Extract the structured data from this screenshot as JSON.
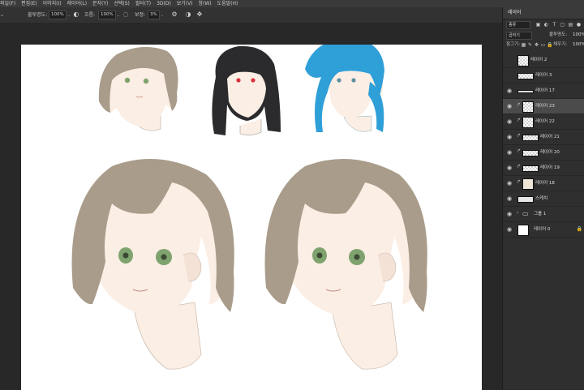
{
  "menubar": {
    "items": [
      "파일(F)",
      "편집(E)",
      "이미지(I)",
      "레이어(L)",
      "문자(Y)",
      "선택(S)",
      "필터(T)",
      "3D(D)",
      "보기(V)",
      "창(W)",
      "도움말(H)"
    ]
  },
  "options": {
    "opacity_label": "불투명도:",
    "opacity_value": "100%",
    "flow_label": "흐름:",
    "flow_value": "100%",
    "smoothing_label": "보정:",
    "smoothing_value": "3%"
  },
  "layers_panel": {
    "tab_label": "레이어",
    "filter_kind": "종류",
    "blend_mode": "곱하기",
    "opacity_label": "불투명도:",
    "opacity_value": "100%",
    "lock_label": "잠그기:",
    "fill_label": "채우기:",
    "fill_value": "100%",
    "layers": [
      {
        "name": "레이어 2"
      },
      {
        "name": "레이어 3"
      },
      {
        "name": "레이어 17"
      },
      {
        "name": "레이어 23"
      },
      {
        "name": "레이어 22"
      },
      {
        "name": "레이어 21"
      },
      {
        "name": "레이어 20"
      },
      {
        "name": "레이어 19"
      },
      {
        "name": "레이어 18"
      },
      {
        "name": "스케치"
      },
      {
        "name": "그룹 1"
      },
      {
        "name": "레이어 0"
      }
    ]
  },
  "colors": {
    "hair_brown": "#a99c8a",
    "hair_black": "#2b2b2d",
    "hair_blue": "#2f9fd8",
    "eye_green": "#7fa36e",
    "eye_red": "#d8303e",
    "skin": "#fbeee4"
  }
}
